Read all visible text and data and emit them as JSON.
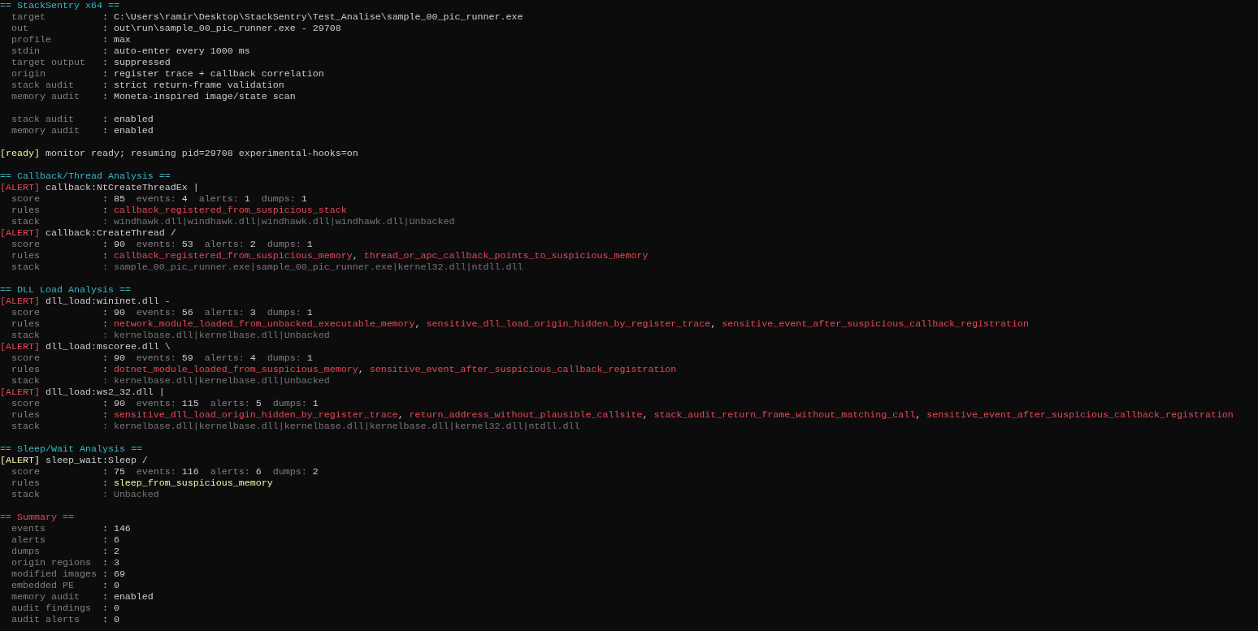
{
  "header": {
    "title": "== StackSentry x64 ==",
    "fields": [
      {
        "label": "target",
        "value": ": C:\\Users\\ramir\\Desktop\\StackSentry\\Test_Analise\\sample_00_pic_runner.exe"
      },
      {
        "label": "out",
        "value": ": out\\run\\sample_00_pic_runner.exe - 29708"
      },
      {
        "label": "profile",
        "value": ": max"
      },
      {
        "label": "stdin",
        "value": ": auto-enter every 1000 ms"
      },
      {
        "label": "target output",
        "value": ": suppressed"
      },
      {
        "label": "origin",
        "value": ": register trace + callback correlation"
      },
      {
        "label": "stack audit",
        "value": ": strict return-frame validation"
      },
      {
        "label": "memory audit",
        "value": ": Moneta-inspired image/state scan"
      }
    ],
    "toggles": [
      {
        "label": "stack audit",
        "value": ": enabled"
      },
      {
        "label": "memory audit",
        "value": ": enabled"
      }
    ]
  },
  "status": {
    "tag": "[ready]",
    "message": "monitor ready; resuming pid=29708 experimental-hooks=on"
  },
  "sections": [
    {
      "title": "== Callback/Thread Analysis ==",
      "kind": "analysis",
      "alerts": [
        {
          "tag": "[ALERT]",
          "color": "#e74856",
          "name": "callback:NtCreateThreadEx |",
          "score_label": "score",
          "score": ": 85",
          "metrics": [
            {
              "label": "events:",
              "value": "4"
            },
            {
              "label": "alerts:",
              "value": "1"
            },
            {
              "label": "dumps:",
              "value": "1"
            }
          ],
          "rules_label": "rules",
          "rules_sep": ":",
          "rules": [
            {
              "text": "callback_registered_from_suspicious_stack"
            }
          ],
          "stack_label": "stack",
          "stack": ": windhawk.dll|windhawk.dll|windhawk.dll|windhawk.dll|Unbacked"
        },
        {
          "tag": "[ALERT]",
          "color": "#e74856",
          "name": "callback:CreateThread /",
          "score_label": "score",
          "score": ": 90",
          "metrics": [
            {
              "label": "events:",
              "value": "53"
            },
            {
              "label": "alerts:",
              "value": "2"
            },
            {
              "label": "dumps:",
              "value": "1"
            }
          ],
          "rules_label": "rules",
          "rules_sep": ":",
          "rules": [
            {
              "text": "callback_registered_from_suspicious_memory",
              "after": ","
            },
            {
              "text": "thread_or_apc_callback_points_to_suspicious_memory"
            }
          ],
          "stack_label": "stack",
          "stack": ": sample_00_pic_runner.exe|sample_00_pic_runner.exe|kernel32.dll|ntdll.dll"
        }
      ]
    },
    {
      "title": "== DLL Load Analysis ==",
      "kind": "analysis",
      "alerts": [
        {
          "tag": "[ALERT]",
          "color": "#e74856",
          "name": "dll_load:wininet.dll -",
          "score_label": "score",
          "score": ": 90",
          "metrics": [
            {
              "label": "events:",
              "value": "56"
            },
            {
              "label": "alerts:",
              "value": "3"
            },
            {
              "label": "dumps:",
              "value": "1"
            }
          ],
          "rules_label": "rules",
          "rules_sep": ":",
          "rules": [
            {
              "text": "network_module_loaded_from_unbacked_executable_memory",
              "after": ","
            },
            {
              "text": "sensitive_dll_load_origin_hidden_by_register_trace",
              "after": ","
            },
            {
              "text": "sensitive_event_after_suspicious_callback_registration"
            }
          ],
          "stack_label": "stack",
          "stack": ": kernelbase.dll|kernelbase.dll|Unbacked"
        },
        {
          "tag": "[ALERT]",
          "color": "#e74856",
          "name": "dll_load:mscoree.dll \\",
          "score_label": "score",
          "score": ": 90",
          "metrics": [
            {
              "label": "events:",
              "value": "59"
            },
            {
              "label": "alerts:",
              "value": "4"
            },
            {
              "label": "dumps:",
              "value": "1"
            }
          ],
          "rules_label": "rules",
          "rules_sep": ":",
          "rules": [
            {
              "text": "dotnet_module_loaded_from_suspicious_memory",
              "after": ","
            },
            {
              "text": "sensitive_event_after_suspicious_callback_registration"
            }
          ],
          "stack_label": "stack",
          "stack": ": kernelbase.dll|kernelbase.dll|Unbacked"
        },
        {
          "tag": "[ALERT]",
          "color": "#e74856",
          "name": "dll_load:ws2_32.dll |",
          "score_label": "score",
          "score": ": 90",
          "metrics": [
            {
              "label": "events:",
              "value": "115"
            },
            {
              "label": "alerts:",
              "value": "5"
            },
            {
              "label": "dumps:",
              "value": "1"
            }
          ],
          "rules_label": "rules",
          "rules_sep": ":",
          "rules": [
            {
              "text": "sensitive_dll_load_origin_hidden_by_register_trace",
              "after": ","
            },
            {
              "text": "return_address_without_plausible_callsite",
              "after": ","
            },
            {
              "text": "stack_audit_return_frame_without_matching_call",
              "after": ","
            },
            {
              "text": "sensitive_event_after_suspicious_callback_registration"
            }
          ],
          "stack_label": "stack",
          "stack": ": kernelbase.dll|kernelbase.dll|kernelbase.dll|kernelbase.dll|kernel32.dll|ntdll.dll"
        }
      ]
    },
    {
      "title": "== Sleep/Wait Analysis ==",
      "kind": "analysis",
      "alerts": [
        {
          "tag": "[ALERT]",
          "color": "#f9f1a5",
          "name": "sleep_wait:Sleep /",
          "score_label": "score",
          "score": ": 75",
          "metrics": [
            {
              "label": "events:",
              "value": "116"
            },
            {
              "label": "alerts:",
              "value": "6"
            },
            {
              "label": "dumps:",
              "value": "2"
            }
          ],
          "rules_label": "rules",
          "rules_sep": ":",
          "rules": [
            {
              "text": "sleep_from_suspicious_memory"
            }
          ],
          "stack_label": "stack",
          "stack": ": Unbacked"
        }
      ]
    }
  ],
  "summary": {
    "title": "== Summary ==",
    "kind": "summary",
    "fields": [
      {
        "label": "events",
        "value": ": 146"
      },
      {
        "label": "alerts",
        "value": ": 6"
      },
      {
        "label": "dumps",
        "value": ": 2"
      },
      {
        "label": "origin regions",
        "value": ": 3"
      },
      {
        "label": "modified images",
        "value": ": 69"
      },
      {
        "label": "embedded PE",
        "value": ": 0"
      },
      {
        "label": "memory audit",
        "value": ": enabled"
      },
      {
        "label": "audit findings",
        "value": ": 0"
      },
      {
        "label": "audit alerts",
        "value": ": 0"
      }
    ]
  }
}
